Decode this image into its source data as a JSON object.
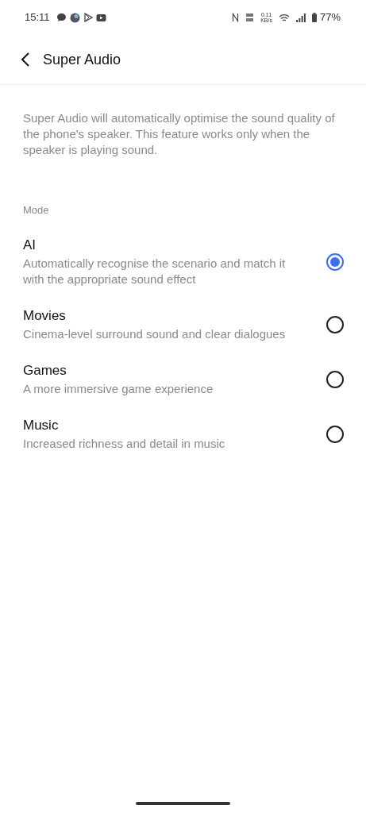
{
  "status_bar": {
    "time": "15:11",
    "network_speed": [
      "0.11",
      "KB/s"
    ],
    "battery": "77%"
  },
  "header": {
    "title": "Super Audio"
  },
  "description": "Super Audio will automatically optimise the sound quality of the phone's speaker. This feature works only when the speaker is playing sound.",
  "section": {
    "label": "Mode"
  },
  "modes": [
    {
      "title": "AI",
      "subtitle": "Automatically recognise the scenario and match it with the appropriate sound effect",
      "selected": true
    },
    {
      "title": "Movies",
      "subtitle": "Cinema-level surround sound and clear dialogues",
      "selected": false
    },
    {
      "title": "Games",
      "subtitle": "A more immersive game experience",
      "selected": false
    },
    {
      "title": "Music",
      "subtitle": "Increased richness and detail in music",
      "selected": false
    }
  ]
}
